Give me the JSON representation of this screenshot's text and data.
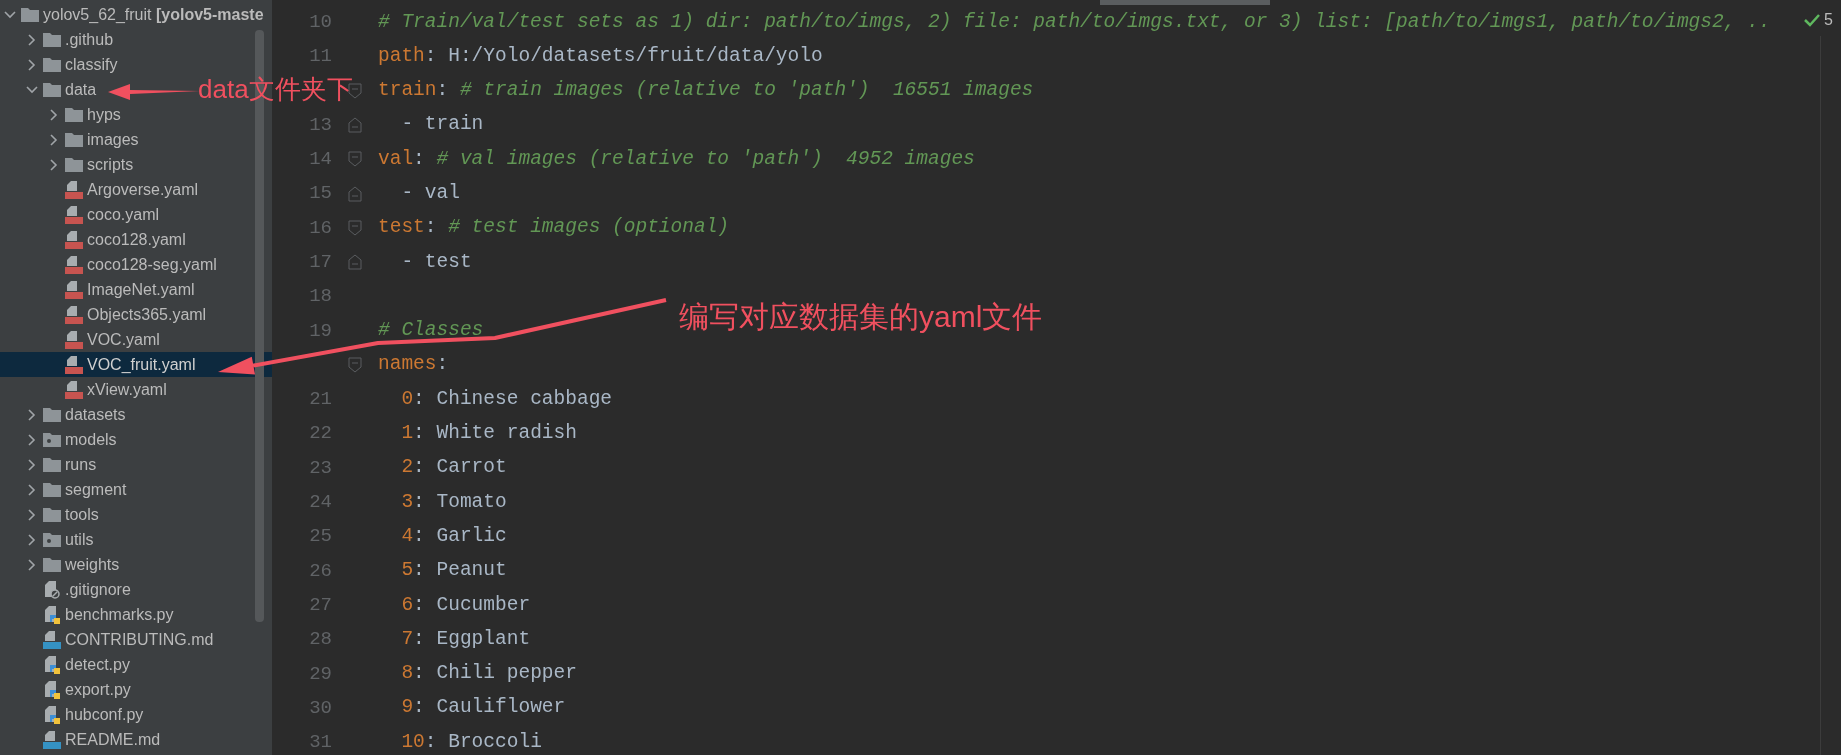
{
  "project_tree": [
    {
      "label": "yolov5_62_fruit **[yolov5-maste**",
      "kind": "folder",
      "expanded": true,
      "selected": false,
      "children": [
        {
          "label": ".github",
          "kind": "folder",
          "expanded": false,
          "selected": false
        },
        {
          "label": "classify",
          "kind": "folder",
          "expanded": false,
          "selected": false
        },
        {
          "label": "data",
          "kind": "folder",
          "expanded": true,
          "selected": false,
          "children": [
            {
              "label": "hyps",
              "kind": "folder",
              "expanded": false,
              "selected": false
            },
            {
              "label": "images",
              "kind": "folder",
              "expanded": false,
              "selected": false
            },
            {
              "label": "scripts",
              "kind": "folder",
              "expanded": false,
              "selected": false
            },
            {
              "label": "Argoverse.yaml",
              "kind": "yaml",
              "selected": false
            },
            {
              "label": "coco.yaml",
              "kind": "yaml",
              "selected": false
            },
            {
              "label": "coco128.yaml",
              "kind": "yaml",
              "selected": false
            },
            {
              "label": "coco128-seg.yaml",
              "kind": "yaml",
              "selected": false
            },
            {
              "label": "ImageNet.yaml",
              "kind": "yaml",
              "selected": false
            },
            {
              "label": "Objects365.yaml",
              "kind": "yaml",
              "selected": false
            },
            {
              "label": "VOC.yaml",
              "kind": "yaml",
              "selected": false
            },
            {
              "label": "VOC_fruit.yaml",
              "kind": "yaml",
              "selected": true
            },
            {
              "label": "xView.yaml",
              "kind": "yaml",
              "selected": false
            }
          ]
        },
        {
          "label": "datasets",
          "kind": "folder",
          "expanded": false,
          "selected": false
        },
        {
          "label": "models",
          "kind": "package",
          "expanded": false,
          "selected": false
        },
        {
          "label": "runs",
          "kind": "folder",
          "expanded": false,
          "selected": false
        },
        {
          "label": "segment",
          "kind": "folder",
          "expanded": false,
          "selected": false
        },
        {
          "label": "tools",
          "kind": "folder",
          "expanded": false,
          "selected": false
        },
        {
          "label": "utils",
          "kind": "package",
          "expanded": false,
          "selected": false
        },
        {
          "label": "weights",
          "kind": "folder",
          "expanded": false,
          "selected": false
        },
        {
          "label": ".gitignore",
          "kind": "ignored",
          "selected": false
        },
        {
          "label": "benchmarks.py",
          "kind": "python",
          "selected": false
        },
        {
          "label": "CONTRIBUTING.md",
          "kind": "markdown",
          "selected": false
        },
        {
          "label": "detect.py",
          "kind": "python",
          "selected": false
        },
        {
          "label": "export.py",
          "kind": "python",
          "selected": false
        },
        {
          "label": "hubconf.py",
          "kind": "python",
          "selected": false
        },
        {
          "label": "README.md",
          "kind": "markdown",
          "selected": false
        }
      ]
    }
  ],
  "editor": {
    "inspections": {
      "count": "5"
    },
    "lines": [
      {
        "number": "10",
        "kind": "plain",
        "segments": [
          {
            "kind": "comment",
            "text": "# Train/val/test sets as 1) dir: path/to/imgs, 2) file: path/to/imgs.txt, or 3) list: [path/to/imgs1, path/to/imgs2, .."
          }
        ]
      },
      {
        "number": "11",
        "kind": "plain",
        "segments": [
          {
            "kind": "key",
            "text": "path"
          },
          {
            "kind": "punct",
            "text": ": "
          },
          {
            "kind": "text",
            "text": "H:/Yolo/datasets/fruit/data/yolo"
          }
        ]
      },
      {
        "kind": "fold_start",
        "segments": [
          {
            "kind": "key",
            "text": "train"
          },
          {
            "kind": "punct",
            "text": ": "
          },
          {
            "kind": "comment",
            "text": "# train images (relative to 'path')  16551 images"
          }
        ]
      },
      {
        "number": "13",
        "kind": "fold_end",
        "segments": [
          {
            "kind": "text",
            "text": "  - train"
          }
        ]
      },
      {
        "number": "14",
        "kind": "fold_start",
        "segments": [
          {
            "kind": "key",
            "text": "val"
          },
          {
            "kind": "punct",
            "text": ": "
          },
          {
            "kind": "comment",
            "text": "# val images (relative to 'path')  4952 images"
          }
        ]
      },
      {
        "number": "15",
        "kind": "fold_end",
        "segments": [
          {
            "kind": "text",
            "text": "  - val"
          }
        ]
      },
      {
        "number": "16",
        "kind": "fold_start",
        "segments": [
          {
            "kind": "key",
            "text": "test"
          },
          {
            "kind": "punct",
            "text": ": "
          },
          {
            "kind": "comment",
            "text": "# test images (optional)"
          }
        ]
      },
      {
        "number": "17",
        "kind": "fold_end",
        "segments": [
          {
            "kind": "text",
            "text": "  - test"
          }
        ]
      },
      {
        "number": "18",
        "kind": "plain"
      },
      {
        "number": "19",
        "kind": "plain",
        "segments": [
          {
            "kind": "comment",
            "text": "# Classes"
          }
        ]
      },
      {
        "kind": "fold_start",
        "segments": [
          {
            "kind": "key",
            "text": "names"
          },
          {
            "kind": "punct",
            "text": ":"
          }
        ]
      },
      {
        "number": "21",
        "kind": "plain",
        "segments": [
          {
            "kind": "number",
            "text": "  0"
          },
          {
            "kind": "punct",
            "text": ": "
          },
          {
            "kind": "text",
            "text": "Chinese cabbage"
          }
        ]
      },
      {
        "number": "22",
        "kind": "plain",
        "segments": [
          {
            "kind": "number",
            "text": "  1"
          },
          {
            "kind": "punct",
            "text": ": "
          },
          {
            "kind": "text",
            "text": "White radish"
          }
        ]
      },
      {
        "number": "23",
        "kind": "plain",
        "segments": [
          {
            "kind": "number",
            "text": "  2"
          },
          {
            "kind": "punct",
            "text": ": "
          },
          {
            "kind": "text",
            "text": "Carrot"
          }
        ]
      },
      {
        "number": "24",
        "kind": "plain",
        "segments": [
          {
            "kind": "number",
            "text": "  3"
          },
          {
            "kind": "punct",
            "text": ": "
          },
          {
            "kind": "text",
            "text": "Tomato"
          }
        ]
      },
      {
        "number": "25",
        "kind": "plain",
        "segments": [
          {
            "kind": "number",
            "text": "  4"
          },
          {
            "kind": "punct",
            "text": ": "
          },
          {
            "kind": "text",
            "text": "Garlic"
          }
        ]
      },
      {
        "number": "26",
        "kind": "plain",
        "segments": [
          {
            "kind": "number",
            "text": "  5"
          },
          {
            "kind": "punct",
            "text": ": "
          },
          {
            "kind": "text",
            "text": "Peanut"
          }
        ]
      },
      {
        "number": "27",
        "kind": "plain",
        "segments": [
          {
            "kind": "number",
            "text": "  6"
          },
          {
            "kind": "punct",
            "text": ": "
          },
          {
            "kind": "text",
            "text": "Cucumber"
          }
        ]
      },
      {
        "number": "28",
        "kind": "plain",
        "segments": [
          {
            "kind": "number",
            "text": "  7"
          },
          {
            "kind": "punct",
            "text": ": "
          },
          {
            "kind": "text",
            "text": "Eggplant"
          }
        ]
      },
      {
        "number": "29",
        "kind": "plain",
        "segments": [
          {
            "kind": "number",
            "text": "  8"
          },
          {
            "kind": "punct",
            "text": ": "
          },
          {
            "kind": "text",
            "text": "Chili pepper"
          }
        ]
      },
      {
        "number": "30",
        "kind": "plain",
        "segments": [
          {
            "kind": "number",
            "text": "  9"
          },
          {
            "kind": "punct",
            "text": ": "
          },
          {
            "kind": "text",
            "text": "Cauliflower"
          }
        ]
      },
      {
        "number": "31",
        "kind": "plain",
        "segments": [
          {
            "kind": "number",
            "text": "  10"
          },
          {
            "kind": "punct",
            "text": ": "
          },
          {
            "kind": "text",
            "text": "Broccoli"
          }
        ]
      }
    ]
  },
  "annotations": [
    {
      "text": "data文件夹下"
    },
    {
      "text": "编写对应数据集的yaml文件"
    }
  ]
}
